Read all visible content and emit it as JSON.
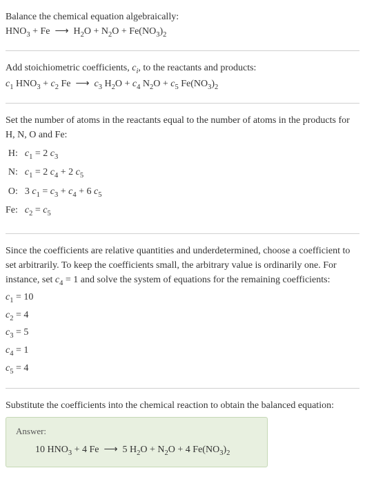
{
  "intro": {
    "line1": "Balance the chemical equation algebraically:",
    "equation": "HNO₃ + Fe ⟶ H₂O + N₂O + Fe(NO₃)₂"
  },
  "stoich": {
    "line1_pre": "Add stoichiometric coefficients, ",
    "line1_var": "cᵢ",
    "line1_post": ", to the reactants and products:",
    "equation": "c₁ HNO₃ + c₂ Fe ⟶ c₃ H₂O + c₄ N₂O + c₅ Fe(NO₃)₂"
  },
  "atoms": {
    "intro": "Set the number of atoms in the reactants equal to the number of atoms in the products for H, N, O and Fe:",
    "rows": [
      {
        "label": "H:",
        "expr": "c₁ = 2 c₃"
      },
      {
        "label": "N:",
        "expr": "c₁ = 2 c₄ + 2 c₅"
      },
      {
        "label": "O:",
        "expr": "3 c₁ = c₃ + c₄ + 6 c₅"
      },
      {
        "label": "Fe:",
        "expr": "c₂ = c₅"
      }
    ]
  },
  "solve": {
    "intro_pre": "Since the coefficients are relative quantities and underdetermined, choose a coefficient to set arbitrarily. To keep the coefficients small, the arbitrary value is ordinarily one. For instance, set ",
    "intro_var": "c₄ = 1",
    "intro_post": " and solve the system of equations for the remaining coefficients:",
    "coeffs": [
      "c₁ = 10",
      "c₂ = 4",
      "c₃ = 5",
      "c₄ = 1",
      "c₅ = 4"
    ]
  },
  "substitute": {
    "text": "Substitute the coefficients into the chemical reaction to obtain the balanced equation:"
  },
  "answer": {
    "label": "Answer:",
    "equation": "10 HNO₃ + 4 Fe ⟶ 5 H₂O + N₂O + 4 Fe(NO₃)₂"
  }
}
